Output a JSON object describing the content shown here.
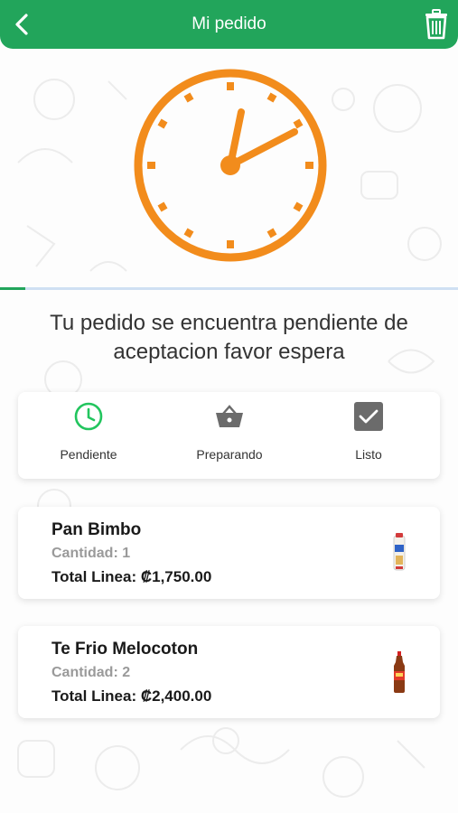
{
  "header": {
    "title": "Mi pedido",
    "back_icon": "chevron-left-icon",
    "trash_icon": "trash-icon",
    "color": "#22a55b"
  },
  "clock": {
    "icon": "clock-icon",
    "color": "#f28c1c"
  },
  "progress": {
    "fraction": 0.055
  },
  "message": "Tu pedido se encuentra pendiente de aceptacion favor espera",
  "status_steps": [
    {
      "label": "Pendiente",
      "icon": "clock-outline-icon",
      "active": true
    },
    {
      "label": "Preparando",
      "icon": "basket-icon",
      "active": false
    },
    {
      "label": "Listo",
      "icon": "checkbox-icon",
      "active": false
    }
  ],
  "items": [
    {
      "name": "Pan Bimbo",
      "quantity": "Cantidad: 1",
      "total": "Total Linea: ₡1,750.00",
      "image": "bread-bag-image"
    },
    {
      "name": "Te Frio Melocoton",
      "quantity": "Cantidad: 2",
      "total": "Total Linea: ₡2,400.00",
      "image": "tea-bottle-image"
    }
  ]
}
